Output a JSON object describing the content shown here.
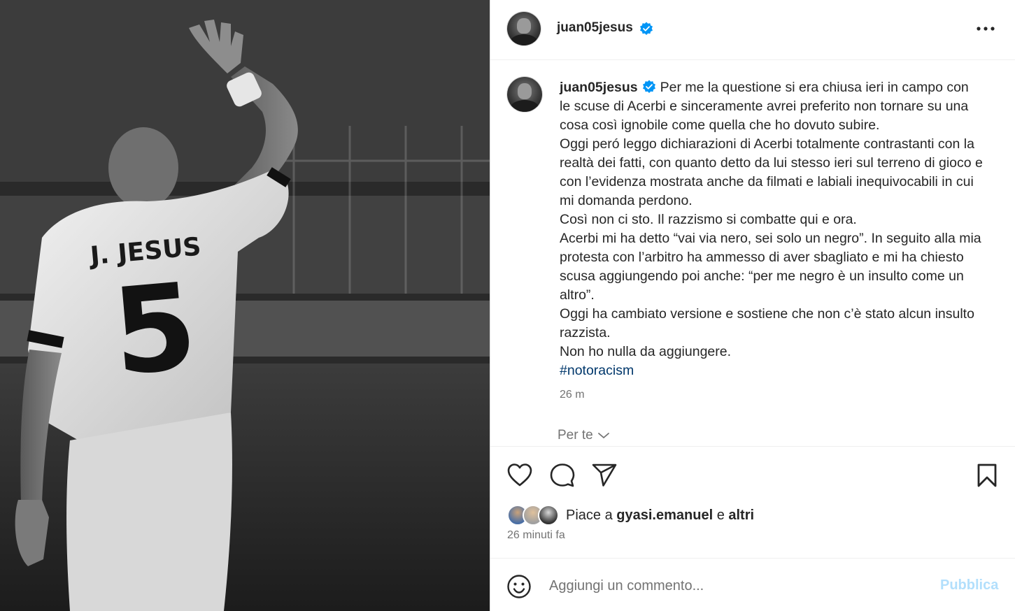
{
  "post": {
    "username": "juan05jesus",
    "caption": {
      "paragraphs": [
        "Per me la questione si era chiusa ieri in campo con le scuse di Acerbi e sinceramente avrei preferito non tornare su una cosa così ignobile come quella che ho dovuto subire.",
        "Oggi peró leggo dichiarazioni di Acerbi totalmente contrastanti con la realtà dei fatti, con quanto detto da lui stesso ieri sul terreno di gioco e con l’evidenza mostrata anche da filmati e labiali inequivocabili in cui mi domanda perdono.",
        "Così non ci sto. Il razzismo si combatte qui e ora.",
        "Acerbi mi ha detto “vai via nero, sei solo un negro”. In seguito alla mia protesta con l’arbitro ha ammesso di aver sbagliato e mi ha chiesto scusa aggiungendo poi anche: “per me negro è un insulto come un altro”.",
        "Oggi ha cambiato versione e sostiene che non c’è stato alcun insulto razzista.",
        "Non ho nulla da aggiungere."
      ],
      "hashtag": "#notoracism",
      "time": "26 m"
    },
    "per_te_label": "Per te",
    "likes": {
      "prefix": "Piace a",
      "user": "gyasi.emanuel",
      "conjunction": "e",
      "others": "altri"
    },
    "posted_time": "26 minuti fa",
    "comment": {
      "placeholder": "Aggiungi un commento...",
      "publish_label": "Pubblica"
    },
    "photo": {
      "jersey_name": "J. JESUS",
      "jersey_number": "5"
    }
  },
  "icons": {
    "more": "more-options-icon",
    "like": "heart-icon",
    "comment": "comment-bubble-icon",
    "share": "paper-plane-icon",
    "save": "bookmark-icon",
    "emoji": "emoji-smile-icon",
    "verified": "verified-badge-icon",
    "chevron": "chevron-down-icon"
  },
  "colors": {
    "verified_blue": "#0095f6",
    "hashtag_link": "#00376b",
    "publish_disabled": "#b2dffc",
    "secondary_text": "#737373"
  }
}
